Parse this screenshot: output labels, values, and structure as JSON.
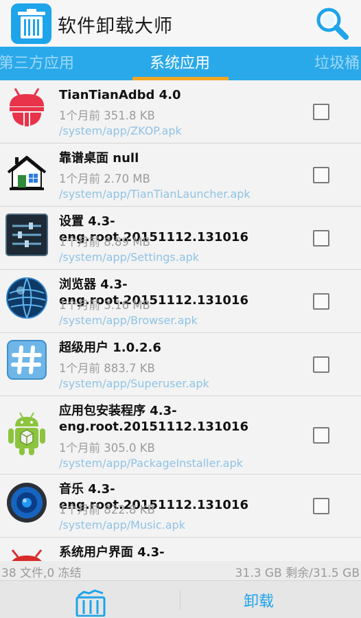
{
  "app": {
    "title": "软件卸载大师"
  },
  "tabs": [
    {
      "label": "第三方应用"
    },
    {
      "label": "系统应用"
    },
    {
      "label": "垃圾桶"
    }
  ],
  "apps": [
    {
      "name": "TianTianAdbd 4.0",
      "meta": "1个月前 351.8 KB",
      "path": "/system/app/ZKOP.apk",
      "icon": "tiantian-icon"
    },
    {
      "name": "靠谱桌面 null",
      "meta": "1个月前 2.70 MB",
      "path": "/system/app/TianTianLauncher.apk",
      "icon": "launcher-icon"
    },
    {
      "name": "设置 4.3-eng.root.20151112.131016",
      "meta": "1个月前 8.89 MB",
      "path": "/system/app/Settings.apk",
      "icon": "settings-icon"
    },
    {
      "name": "浏览器 4.3-eng.root.20151112.131016",
      "meta": "1个月前 3.16 MB",
      "path": "/system/app/Browser.apk",
      "icon": "browser-icon"
    },
    {
      "name": "超级用户 1.0.2.6",
      "meta": "1个月前 883.7 KB",
      "path": "/system/app/Superuser.apk",
      "icon": "superuser-icon"
    },
    {
      "name": "应用包安装程序 4.3-eng.root.20151112.131016",
      "meta": "1个月前 305.0 KB",
      "path": "/system/app/PackageInstaller.apk",
      "icon": "package-installer-icon"
    },
    {
      "name": "音乐 4.3-eng.root.20151112.131016",
      "meta": "1个月前 822.8 KB",
      "path": "/system/app/Music.apk",
      "icon": "music-icon"
    },
    {
      "name": "系统用户界面 4.3-",
      "meta": "",
      "path": "",
      "icon": "system-ui-icon"
    }
  ],
  "status": {
    "files": "38 文件,0 冻结",
    "storage": "31.3 GB 剩余/31.5 GB"
  },
  "bottom": {
    "uninstall_label": "卸载"
  },
  "colors": {
    "accent": "#2aa9ea",
    "indicator": "#f5a623",
    "path_text": "#8fc2e6"
  }
}
